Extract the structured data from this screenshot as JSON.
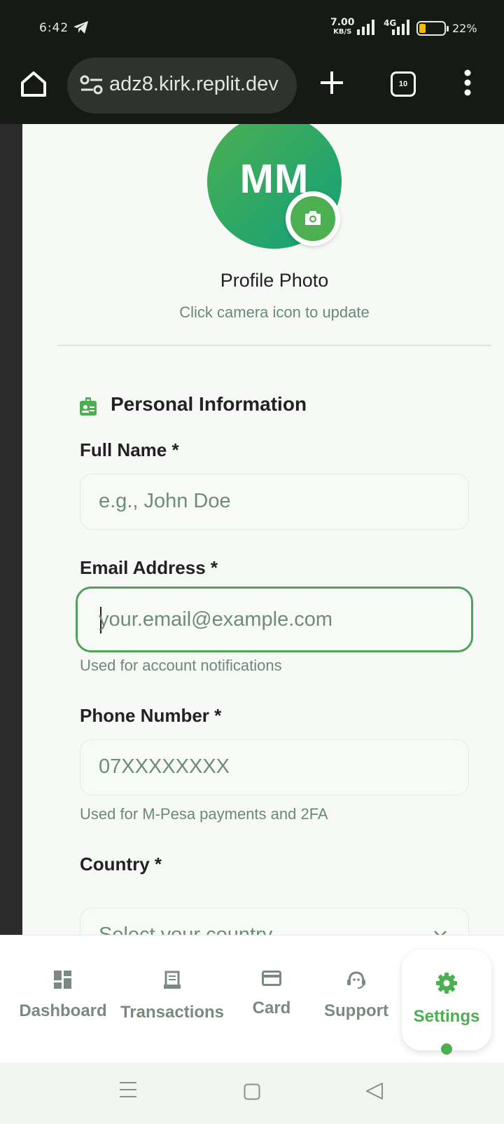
{
  "status_bar": {
    "time": "6:42",
    "net_speed": "7.00",
    "net_speed_unit": "KB/S",
    "network_type": "4G",
    "battery_level": 0.22,
    "battery_percent": "22%",
    "battery_color": "#f5b800"
  },
  "browser": {
    "url": "adz8.kirk.replit.dev",
    "tab_count": "10",
    "icons": [
      "home-icon",
      "site-settings-icon",
      "new-tab-icon",
      "tab-switcher-icon",
      "more-menu-icon"
    ]
  },
  "profile": {
    "initials": "MM",
    "photo_title": "Profile Photo",
    "photo_subtitle": "Click camera icon to update"
  },
  "personal_info": {
    "section_title": "Personal Information",
    "full_name": {
      "label": "Full Name *",
      "placeholder": "e.g., John Doe",
      "value": ""
    },
    "email": {
      "label": "Email Address *",
      "placeholder": "your.email@example.com",
      "value": "",
      "hint": "Used for account notifications"
    },
    "phone": {
      "label": "Phone Number *",
      "placeholder": "07XXXXXXXX",
      "value": "",
      "hint": "Used for M-Pesa payments and 2FA"
    },
    "country": {
      "label": "Country *",
      "placeholder": "Select your country"
    }
  },
  "bottom_nav": {
    "items": [
      {
        "label": "Dashboard",
        "icon": "dashboard-icon"
      },
      {
        "label": "Transactions",
        "icon": "receipt-icon"
      },
      {
        "label": "Card",
        "icon": "card-icon"
      },
      {
        "label": "Support",
        "icon": "support-agent-icon"
      },
      {
        "label": "Settings",
        "icon": "gear-icon",
        "active": true
      }
    ]
  },
  "colors": {
    "accent": "#4caf50",
    "avatar_gradient_end": "#12a07a",
    "muted_text": "#6a8a75",
    "browser_chrome": "#151a15"
  }
}
